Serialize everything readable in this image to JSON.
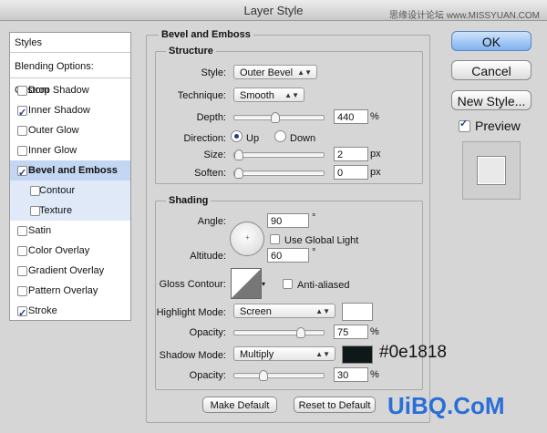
{
  "window": {
    "title": "Layer Style",
    "watermark_top": "思缘设计论坛 www.MISSYUAN.COM",
    "watermark_bottom": "UiBQ.CoM"
  },
  "left_panel": {
    "styles_label": "Styles",
    "blending_label": "Blending Options: Custom",
    "items": [
      {
        "label": "Drop Shadow",
        "checked": false
      },
      {
        "label": "Inner Shadow",
        "checked": true
      },
      {
        "label": "Outer Glow",
        "checked": false
      },
      {
        "label": "Inner Glow",
        "checked": false
      },
      {
        "label": "Bevel and Emboss",
        "checked": true
      },
      {
        "label": "Contour",
        "checked": false
      },
      {
        "label": "Texture",
        "checked": false
      },
      {
        "label": "Satin",
        "checked": false
      },
      {
        "label": "Color Overlay",
        "checked": false
      },
      {
        "label": "Gradient Overlay",
        "checked": false
      },
      {
        "label": "Pattern Overlay",
        "checked": false
      },
      {
        "label": "Stroke",
        "checked": true
      }
    ]
  },
  "bevel": {
    "section_title": "Bevel and Emboss",
    "structure": {
      "title": "Structure",
      "style_label": "Style:",
      "style_value": "Outer Bevel",
      "technique_label": "Technique:",
      "technique_value": "Smooth",
      "depth_label": "Depth:",
      "depth_value": "440",
      "depth_unit": "%",
      "depth_slider": 0.44,
      "direction_label": "Direction:",
      "direction_up": "Up",
      "direction_down": "Down",
      "direction_selected": "Up",
      "size_label": "Size:",
      "size_value": "2",
      "size_unit": "px",
      "size_slider": 0.0,
      "soften_label": "Soften:",
      "soften_value": "0",
      "soften_unit": "px",
      "soften_slider": 0.0
    },
    "shading": {
      "title": "Shading",
      "angle_label": "Angle:",
      "angle_value": "90",
      "angle_unit": "°",
      "global_light_label": "Use Global Light",
      "global_light_checked": false,
      "altitude_label": "Altitude:",
      "altitude_value": "60",
      "altitude_unit": "°",
      "gloss_label": "Gloss Contour:",
      "anti_aliased_label": "Anti-aliased",
      "anti_aliased_checked": false,
      "highlight_label": "Highlight Mode:",
      "highlight_mode": "Screen",
      "highlight_color": "#ffffff",
      "highlight_opacity_label": "Opacity:",
      "highlight_opacity": "75",
      "highlight_opacity_unit": "%",
      "highlight_slider": 0.75,
      "shadow_label": "Shadow Mode:",
      "shadow_mode": "Multiply",
      "shadow_color": "#0e1818",
      "shadow_color_text": "#0e1818",
      "shadow_opacity_label": "Opacity:",
      "shadow_opacity": "30",
      "shadow_opacity_unit": "%",
      "shadow_slider": 0.3
    },
    "make_default": "Make Default",
    "reset_default": "Reset to Default"
  },
  "buttons": {
    "ok": "OK",
    "cancel": "Cancel",
    "new_style": "New Style...",
    "preview_label": "Preview",
    "preview_checked": true
  }
}
